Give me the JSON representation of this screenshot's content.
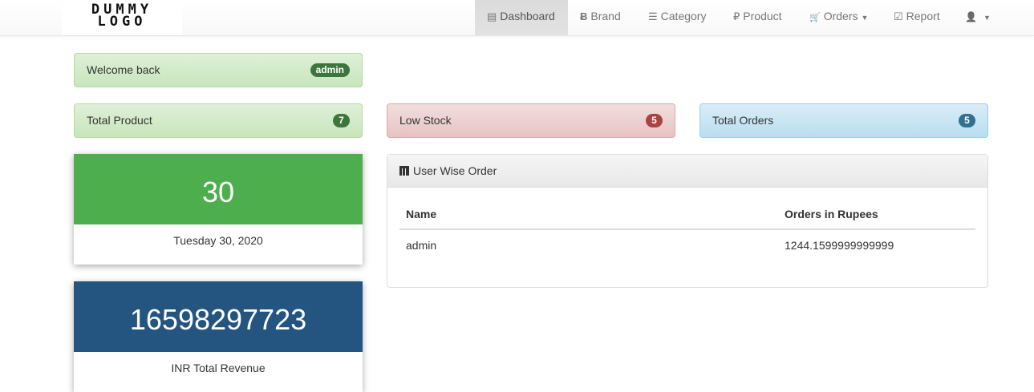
{
  "nav": {
    "logo": "DUMMY LOGO",
    "logo_line1": "DUMMY",
    "logo_line2": "LOGO",
    "items": [
      {
        "label": "Dashboard",
        "icon": "list-alt-icon",
        "glyph": "▤"
      },
      {
        "label": "Brand",
        "icon": "bitcoin-icon",
        "glyph": "Ƀ"
      },
      {
        "label": "Category",
        "icon": "th-list-icon",
        "glyph": "☰"
      },
      {
        "label": "Product",
        "icon": "ruble-icon",
        "glyph": "₽"
      },
      {
        "label": "Orders",
        "icon": "shopping-cart-icon",
        "glyph": "🛒"
      },
      {
        "label": "Report",
        "icon": "check-icon",
        "glyph": "☑"
      }
    ],
    "user_glyph": "👤"
  },
  "welcome": {
    "label": "Welcome back",
    "badge": "admin"
  },
  "stats": [
    {
      "label": "Total Product",
      "value": "7",
      "color": "#3c763d"
    },
    {
      "label": "Low Stock",
      "value": "5",
      "color": "#a94442"
    },
    {
      "label": "Total Orders",
      "value": "5",
      "color": "#31708f"
    }
  ],
  "date_card": {
    "day": "30",
    "date": "Tuesday 30, 2020",
    "color": "#4cae4c"
  },
  "revenue_card": {
    "value": "16598297723",
    "label": "INR Total Revenue",
    "color": "#245580"
  },
  "panel": {
    "title": "User Wise Order",
    "columns": [
      "Name",
      "Orders in Rupees"
    ],
    "rows": [
      [
        "admin",
        "1244.1599999999999"
      ]
    ]
  }
}
